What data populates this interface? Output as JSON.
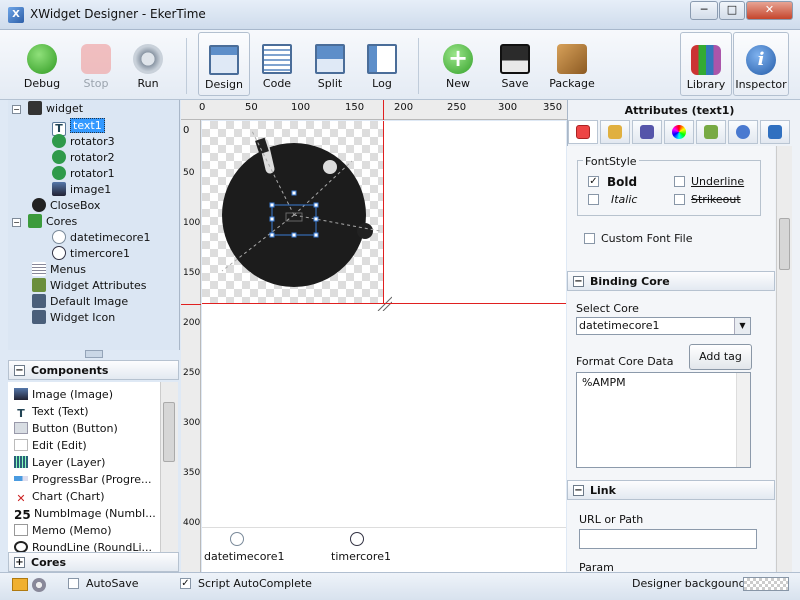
{
  "window": {
    "title": "XWidget Designer - EkerTime",
    "app_icon": "X",
    "min": "─",
    "max": "□",
    "close": "✕"
  },
  "toolbar": {
    "debug": "Debug",
    "stop": "Stop",
    "run": "Run",
    "design": "Design",
    "code": "Code",
    "split": "Split",
    "log": "Log",
    "new": "New",
    "save": "Save",
    "package": "Package",
    "library": "Library",
    "inspector": "Inspector"
  },
  "tree": {
    "widget": "widget",
    "text1": "text1",
    "rotator3": "rotator3",
    "rotator2": "rotator2",
    "rotator1": "rotator1",
    "image1": "image1",
    "closebox": "CloseBox",
    "cores": "Cores",
    "datetimecore1": "datetimecore1",
    "timercore1": "timercore1",
    "menus": "Menus",
    "widget_attributes": "Widget Attributes",
    "default_image": "Default Image",
    "widget_icon": "Widget Icon"
  },
  "components": {
    "header": "Components",
    "items": [
      "Image (Image)",
      "Text (Text)",
      "Button (Button)",
      "Edit (Edit)",
      "Layer (Layer)",
      "ProgressBar (Progre...",
      "Chart (Chart)",
      "NumbImage (NumbI...",
      "Memo (Memo)",
      "RoundLine (RoundLi..."
    ],
    "numb_prefix": "25"
  },
  "cores_panel": {
    "header": "Cores"
  },
  "ruler": {
    "top": [
      "0",
      "50",
      "100",
      "150",
      "200",
      "250",
      "300",
      "350"
    ],
    "left": [
      "0",
      "50",
      "100",
      "150",
      "200",
      "250",
      "300",
      "350",
      "400"
    ]
  },
  "canvas_cores": {
    "datetimecore": "datetimecore1",
    "timercore": "timercore1"
  },
  "inspector": {
    "title": "Attributes (text1)",
    "fontstyle": "FontStyle",
    "bold": "Bold",
    "italic": "Italic",
    "underline": "Underline",
    "strikeout": "Strikeout",
    "bold_checked": "✓",
    "custom_font": "Custom Font File",
    "binding_core": "Binding Core",
    "select_core": "Select Core",
    "select_core_value": "datetimecore1",
    "format_core_data": "Format Core Data",
    "add_tag": "Add tag",
    "format_value": "%AMPM",
    "link": "Link",
    "url_or_path": "URL or Path",
    "param": "Param"
  },
  "status": {
    "autosave": "AutoSave",
    "script_autocomplete": "Script AutoComplete",
    "script_checked": "✓",
    "designer_background": "Designer backgound"
  },
  "colors": {
    "accent": "#3a7bd5",
    "selection": "#3399ff",
    "guide": "#e02020"
  }
}
